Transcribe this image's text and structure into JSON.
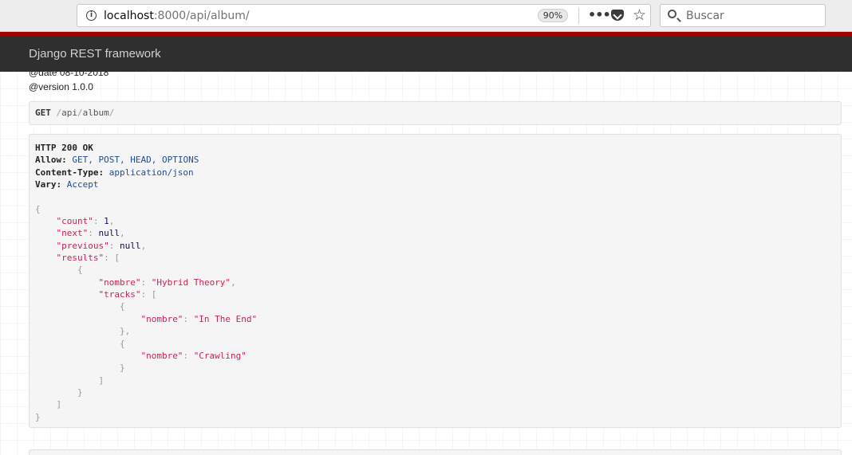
{
  "browser": {
    "url_host": "localhost",
    "url_rest": ":8000/api/album/",
    "zoom": "90%",
    "search_placeholder": "Buscar"
  },
  "navbar": {
    "brand": "Django REST framework"
  },
  "description": {
    "date_line": "@date 08-10-2018",
    "version_line": "@version 1.0.0"
  },
  "request": {
    "method": "GET",
    "path_segment": "api",
    "path_segment2": "album"
  },
  "response": {
    "status": "HTTP 200 OK",
    "allow_label": "Allow:",
    "allow_value": "GET, POST, HEAD, OPTIONS",
    "content_type_label": "Content-Type:",
    "content_type_value": "application/json",
    "vary_label": "Vary:",
    "vary_value": "Accept",
    "body": {
      "count": 1,
      "next": "null",
      "previous": "null",
      "results": [
        {
          "nombre": "Hybrid Theory",
          "tracks": [
            {
              "nombre": "In The End"
            },
            {
              "nombre": "Crawling"
            }
          ]
        }
      ]
    },
    "keys": {
      "count": "\"count\"",
      "next": "\"next\"",
      "previous": "\"previous\"",
      "results": "\"results\"",
      "nombre": "\"nombre\"",
      "tracks": "\"tracks\""
    },
    "strings": {
      "album_name": "\"Hybrid Theory\"",
      "track1": "\"In The End\"",
      "track2": "\"Crawling\""
    }
  }
}
